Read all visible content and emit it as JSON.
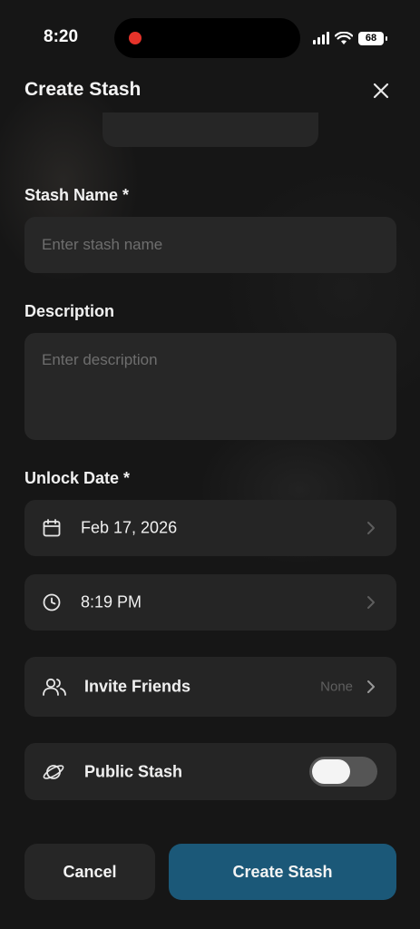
{
  "status_bar": {
    "time": "8:20",
    "battery": "68"
  },
  "header": {
    "title": "Create Stash"
  },
  "form": {
    "name_label": "Stash Name *",
    "name_placeholder": "Enter stash name",
    "description_label": "Description",
    "description_placeholder": "Enter description",
    "unlock_label": "Unlock Date *",
    "date_value": "Feb 17, 2026",
    "time_value": "8:19 PM",
    "invite_label": "Invite Friends",
    "invite_value": "None",
    "public_label": "Public Stash",
    "public_enabled": false
  },
  "actions": {
    "cancel": "Cancel",
    "create": "Create Stash"
  },
  "colors": {
    "background": "#161616",
    "field": "#272727",
    "primary": "#1b5878"
  },
  "icons": {
    "close": "close-icon",
    "calendar": "calendar-icon",
    "clock": "clock-icon",
    "friends": "users-icon",
    "public": "planet-icon",
    "chevron": "chevron-right-icon"
  }
}
